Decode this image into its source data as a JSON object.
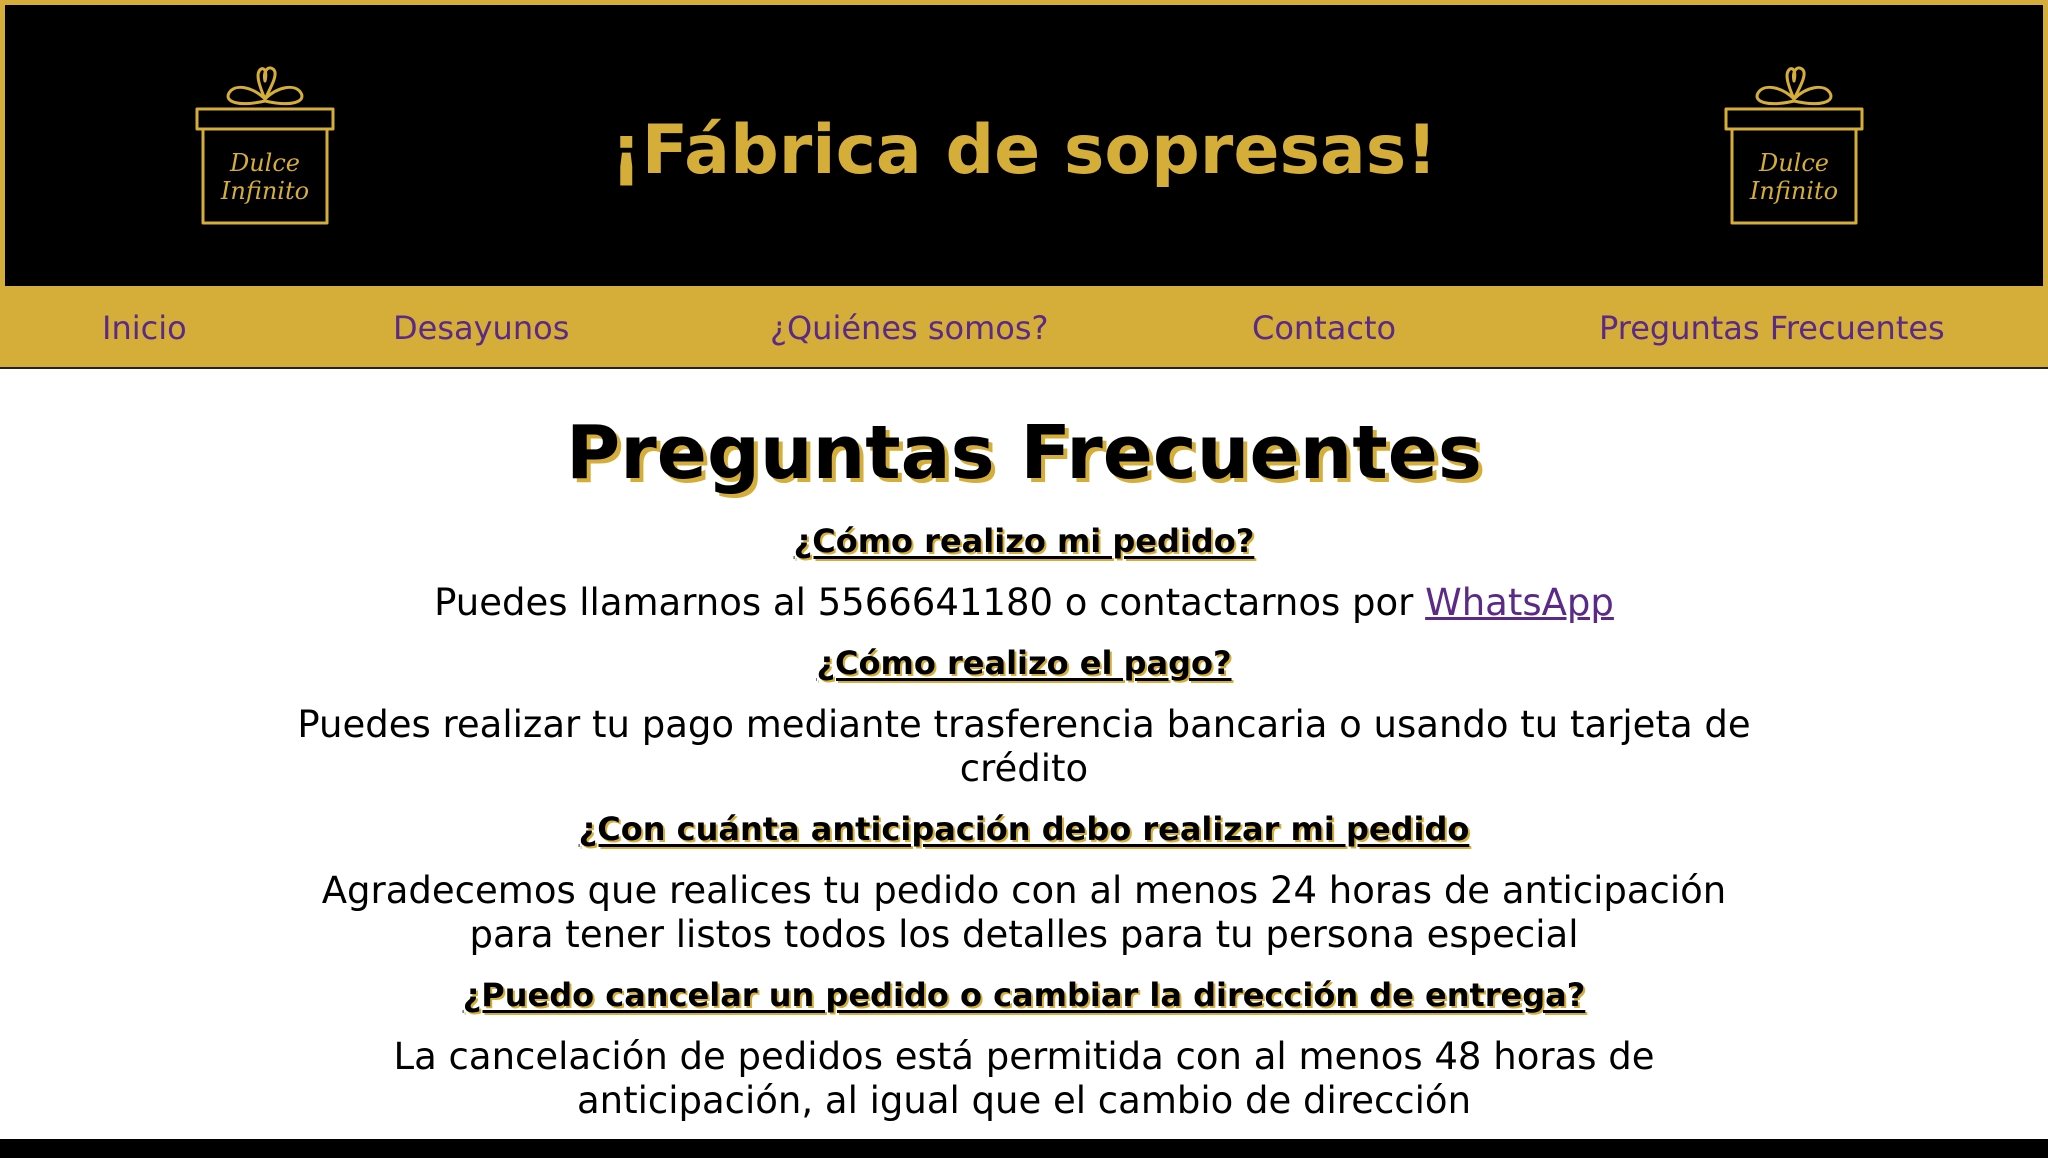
{
  "header": {
    "title": "¡Fábrica de sopresas!",
    "logo_line1": "Dulce",
    "logo_line2": "Infinito"
  },
  "nav": {
    "items": [
      {
        "label": "Inicio"
      },
      {
        "label": "Desayunos"
      },
      {
        "label": "¿Quiénes somos?"
      },
      {
        "label": "Contacto"
      },
      {
        "label": "Preguntas Frecuentes"
      }
    ]
  },
  "main": {
    "title": "Preguntas Frecuentes",
    "faqs": [
      {
        "question": "¿Cómo realizo mi pedido?",
        "answer_text": "Puedes llamarnos al 5566641180 o contactarnos por ",
        "answer_link": "WhatsApp"
      },
      {
        "question": "¿Cómo realizo el pago?",
        "answer_text": "Puedes realizar tu pago mediante trasferencia bancaria o usando tu tarjeta de crédito"
      },
      {
        "question": "¿Con cuánta anticipación debo realizar mi pedido",
        "answer_text": "Agradecemos que realices tu pedido con al menos 24 horas de anticipación para tener listos todos los detalles para tu persona especial"
      },
      {
        "question": "¿Puedo cancelar un pedido o cambiar la dirección de entrega?",
        "answer_text": "La cancelación de pedidos está permitida con al menos 48 horas de anticipación, al igual que el cambio de dirección"
      }
    ]
  },
  "colors": {
    "gold": "#d4ae38",
    "black": "#000000",
    "link_purple": "#5a2a86"
  }
}
